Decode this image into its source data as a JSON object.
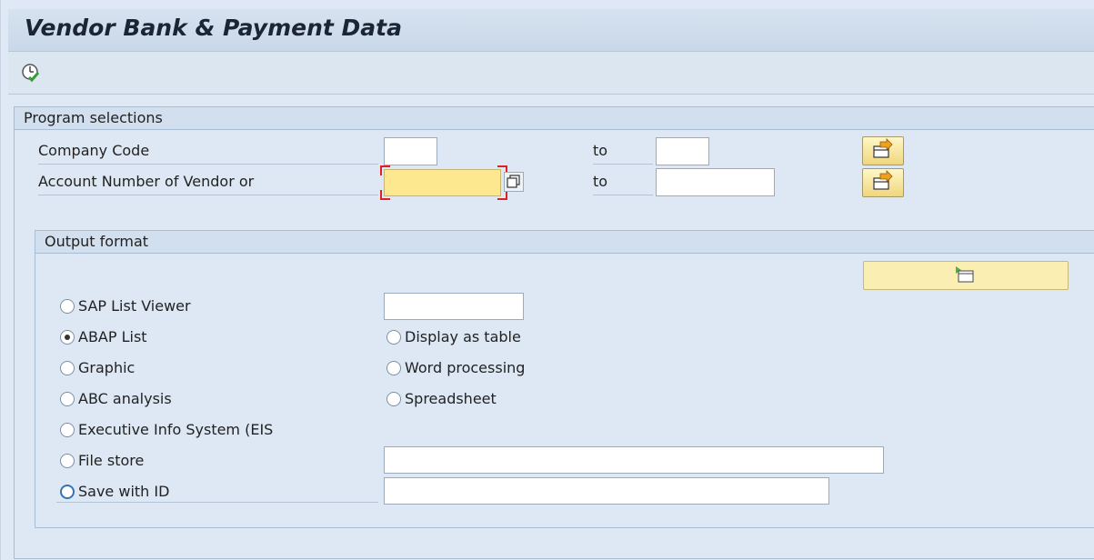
{
  "window": {
    "title": "Vendor Bank & Payment Data"
  },
  "toolbar": {
    "execute_icon": "execute-icon"
  },
  "selections": {
    "title": "Program selections",
    "rows": [
      {
        "label": "Company Code",
        "to_label": "to",
        "from_value": "",
        "to_value": ""
      },
      {
        "label": "Account Number of Vendor or",
        "to_label": "to",
        "from_value": "",
        "to_value": ""
      }
    ]
  },
  "output": {
    "title": "Output format",
    "options": {
      "sap_list_viewer": "SAP List Viewer",
      "abap_list": "ABAP List",
      "graphic": "Graphic",
      "abc_analysis": "ABC analysis",
      "eis": "Executive Info System (EIS",
      "file_store": "File store",
      "save_with_id": "Save with ID",
      "display_as_table": "Display as table",
      "word_processing": "Word processing",
      "spreadsheet": "Spreadsheet"
    },
    "selected": "abap_list",
    "layout_value": "",
    "file_store_value": "",
    "save_id_value": ""
  },
  "colors": {
    "focus_field": "#fde88f",
    "selection_bg": "#dde8f4",
    "accent": "#3573b5"
  }
}
